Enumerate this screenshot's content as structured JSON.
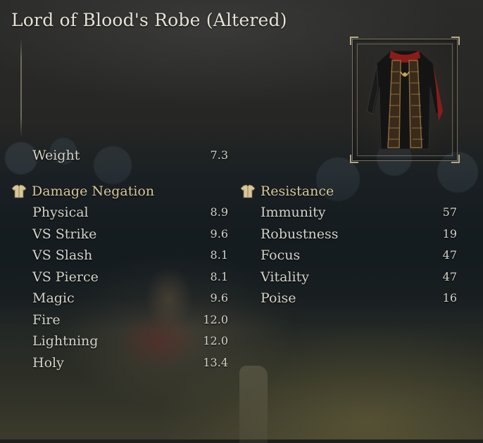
{
  "item": {
    "title": "Lord of Blood's Robe (Altered)",
    "weight_label": "Weight",
    "weight_value": "7.3"
  },
  "damage_negation": {
    "heading": "Damage Negation",
    "icon": "armor-icon",
    "rows": [
      {
        "label": "Physical",
        "value": "8.9"
      },
      {
        "label": "VS Strike",
        "value": "9.6"
      },
      {
        "label": "VS Slash",
        "value": "8.1"
      },
      {
        "label": "VS Pierce",
        "value": "8.1"
      },
      {
        "label": "Magic",
        "value": "9.6"
      },
      {
        "label": "Fire",
        "value": "12.0"
      },
      {
        "label": "Lightning",
        "value": "12.0"
      },
      {
        "label": "Holy",
        "value": "13.4"
      }
    ]
  },
  "resistance": {
    "heading": "Resistance",
    "icon": "armor-icon",
    "rows": [
      {
        "label": "Immunity",
        "value": "57"
      },
      {
        "label": "Robustness",
        "value": "19"
      },
      {
        "label": "Focus",
        "value": "47"
      },
      {
        "label": "Vitality",
        "value": "47"
      },
      {
        "label": "Poise",
        "value": "16"
      }
    ]
  },
  "colors": {
    "text": "#d4d2c8",
    "heading": "#d9c79a",
    "frame": "#bfae8c"
  }
}
